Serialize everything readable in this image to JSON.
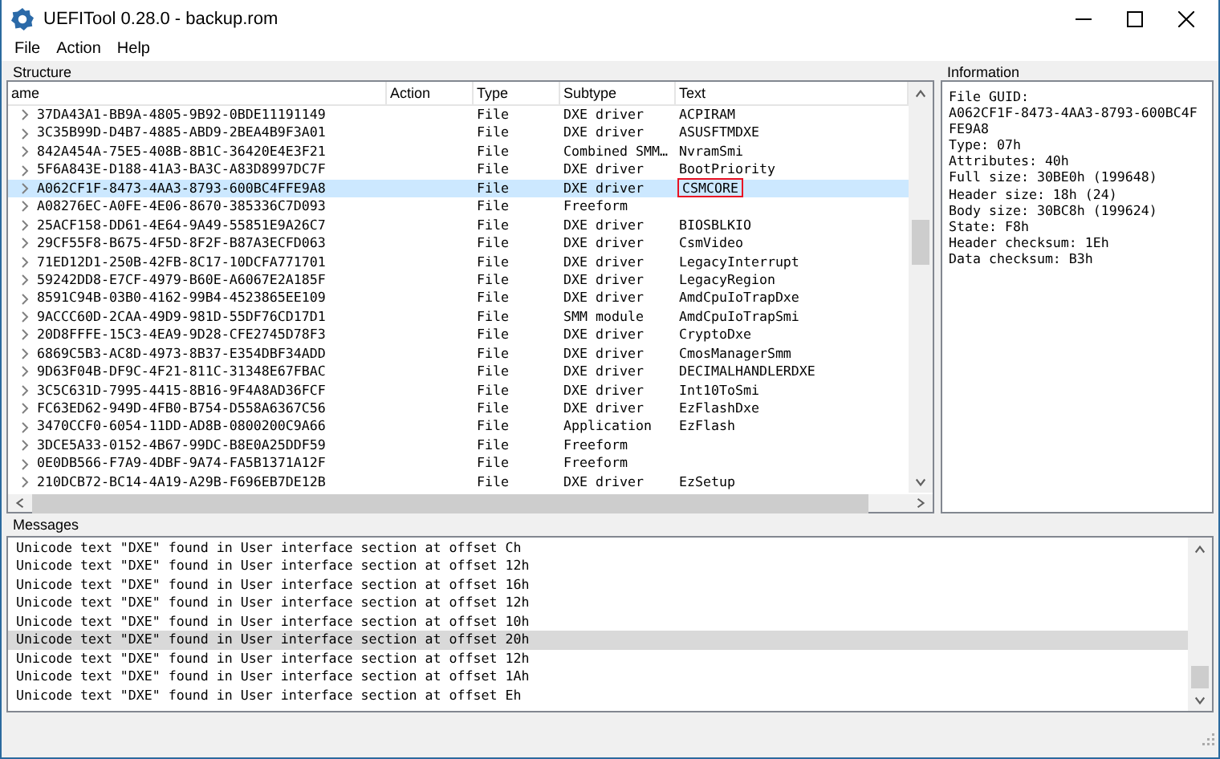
{
  "window": {
    "title": "UEFITool 0.28.0 - backup.rom"
  },
  "menu": [
    "File",
    "Action",
    "Help"
  ],
  "structure": {
    "title": "Structure",
    "columns": [
      "ame",
      "Action",
      "Type",
      "Subtype",
      "Text"
    ],
    "rows": [
      {
        "name": "37DA43A1-BB9A-4805-9B92-0BDE11191149",
        "type": "File",
        "subtype": "DXE driver",
        "text": "ACPIRAM",
        "selected": false,
        "marked": false
      },
      {
        "name": "3C35B99D-D4B7-4885-ABD9-2BEA4B9F3A01",
        "type": "File",
        "subtype": "DXE driver",
        "text": "ASUSFTMDXE",
        "selected": false,
        "marked": false
      },
      {
        "name": "842A454A-75E5-408B-8B1C-36420E4E3F21",
        "type": "File",
        "subtype": "Combined SMM…",
        "text": "NvramSmi",
        "selected": false,
        "marked": false
      },
      {
        "name": "5F6A843E-D188-41A3-BA3C-A83D8997DC7F",
        "type": "File",
        "subtype": "DXE driver",
        "text": "BootPriority",
        "selected": false,
        "marked": false
      },
      {
        "name": "A062CF1F-8473-4AA3-8793-600BC4FFE9A8",
        "type": "File",
        "subtype": "DXE driver",
        "text": "CSMCORE",
        "selected": true,
        "marked": true
      },
      {
        "name": "A08276EC-A0FE-4E06-8670-385336C7D093",
        "type": "File",
        "subtype": "Freeform",
        "text": "",
        "selected": false,
        "marked": false
      },
      {
        "name": "25ACF158-DD61-4E64-9A49-55851E9A26C7",
        "type": "File",
        "subtype": "DXE driver",
        "text": "BIOSBLKIO",
        "selected": false,
        "marked": false
      },
      {
        "name": "29CF55F8-B675-4F5D-8F2F-B87A3ECFD063",
        "type": "File",
        "subtype": "DXE driver",
        "text": "CsmVideo",
        "selected": false,
        "marked": false
      },
      {
        "name": "71ED12D1-250B-42FB-8C17-10DCFA771701",
        "type": "File",
        "subtype": "DXE driver",
        "text": "LegacyInterrupt",
        "selected": false,
        "marked": false
      },
      {
        "name": "59242DD8-E7CF-4979-B60E-A6067E2A185F",
        "type": "File",
        "subtype": "DXE driver",
        "text": "LegacyRegion",
        "selected": false,
        "marked": false
      },
      {
        "name": "8591C94B-03B0-4162-99B4-4523865EE109",
        "type": "File",
        "subtype": "DXE driver",
        "text": "AmdCpuIoTrapDxe",
        "selected": false,
        "marked": false
      },
      {
        "name": "9ACCC60D-2CAA-49D9-981D-55DF76CD17D1",
        "type": "File",
        "subtype": "SMM module",
        "text": "AmdCpuIoTrapSmi",
        "selected": false,
        "marked": false
      },
      {
        "name": "20D8FFFE-15C3-4EA9-9D28-CFE2745D78F3",
        "type": "File",
        "subtype": "DXE driver",
        "text": "CryptoDxe",
        "selected": false,
        "marked": false
      },
      {
        "name": "6869C5B3-AC8D-4973-8B37-E354DBF34ADD",
        "type": "File",
        "subtype": "DXE driver",
        "text": "CmosManagerSmm",
        "selected": false,
        "marked": false
      },
      {
        "name": "9D63F04B-DF9C-4F21-811C-31348E67FBAC",
        "type": "File",
        "subtype": "DXE driver",
        "text": "DECIMALHANDLERDXE",
        "selected": false,
        "marked": false
      },
      {
        "name": "3C5C631D-7995-4415-8B16-9F4A8AD36FCF",
        "type": "File",
        "subtype": "DXE driver",
        "text": "Int10ToSmi",
        "selected": false,
        "marked": false
      },
      {
        "name": "FC63ED62-949D-4FB0-B754-D558A6367C56",
        "type": "File",
        "subtype": "DXE driver",
        "text": "EzFlashDxe",
        "selected": false,
        "marked": false
      },
      {
        "name": "3470CCF0-6054-11DD-AD8B-0800200C9A66",
        "type": "File",
        "subtype": "Application",
        "text": "EzFlash",
        "selected": false,
        "marked": false
      },
      {
        "name": "3DCE5A33-0152-4B67-99DC-B8E0A25DDF59",
        "type": "File",
        "subtype": "Freeform",
        "text": "",
        "selected": false,
        "marked": false
      },
      {
        "name": "0E0DB566-F7A9-4DBF-9A74-FA5B1371A12F",
        "type": "File",
        "subtype": "Freeform",
        "text": "",
        "selected": false,
        "marked": false
      },
      {
        "name": "210DCB72-BC14-4A19-A29B-F696EB7DE12B",
        "type": "File",
        "subtype": "DXE driver",
        "text": "EzSetup",
        "selected": false,
        "marked": false
      }
    ]
  },
  "information": {
    "title": "Information",
    "lines": [
      "File GUID:",
      "A062CF1F-8473-4AA3-8793-600BC4F",
      "FE9A8",
      "Type: 07h",
      "Attributes: 40h",
      "Full size: 30BE0h (199648)",
      "Header size: 18h (24)",
      "Body size: 30BC8h (199624)",
      "State: F8h",
      "Header checksum: 1Eh",
      "Data checksum: B3h"
    ]
  },
  "messages": {
    "title": "Messages",
    "items": [
      {
        "text": "Unicode text \"DXE\" found in User interface section at offset Ch",
        "selected": false
      },
      {
        "text": "Unicode text \"DXE\" found in User interface section at offset 12h",
        "selected": false
      },
      {
        "text": "Unicode text \"DXE\" found in User interface section at offset 16h",
        "selected": false
      },
      {
        "text": "Unicode text \"DXE\" found in User interface section at offset 12h",
        "selected": false
      },
      {
        "text": "Unicode text \"DXE\" found in User interface section at offset 10h",
        "selected": false
      },
      {
        "text": "Unicode text \"DXE\" found in User interface section at offset 20h",
        "selected": true
      },
      {
        "text": "Unicode text \"DXE\" found in User interface section at offset 12h",
        "selected": false
      },
      {
        "text": "Unicode text \"DXE\" found in User interface section at offset 1Ah",
        "selected": false
      },
      {
        "text": "Unicode text \"DXE\" found in User interface section at offset Eh",
        "selected": false
      }
    ]
  }
}
